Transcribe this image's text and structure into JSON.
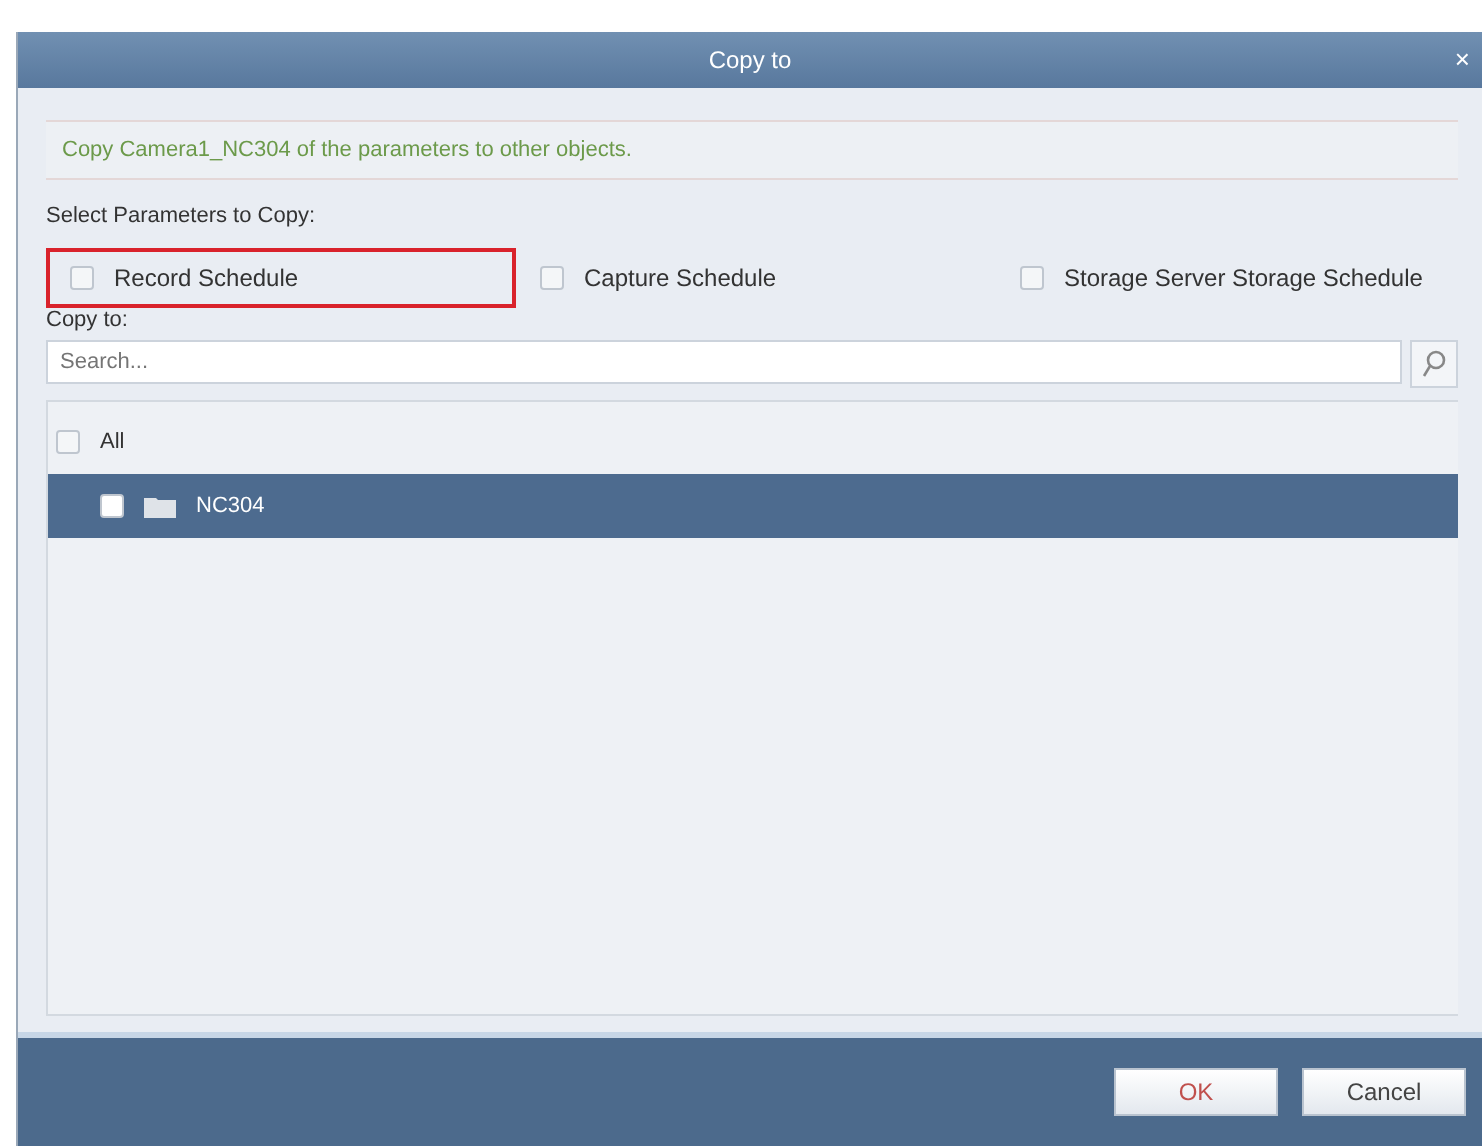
{
  "dialog": {
    "title": "Copy to",
    "close": "×"
  },
  "info": "Copy Camera1_NC304 of the parameters to other objects.",
  "parameters_label": "Select Parameters to Copy:",
  "parameters": [
    {
      "label": "Record Schedule",
      "checked": false,
      "highlighted": true
    },
    {
      "label": "Capture Schedule",
      "checked": false,
      "highlighted": false
    },
    {
      "label": "Storage Server Storage Schedule",
      "checked": false,
      "highlighted": false
    }
  ],
  "copy_to_label": "Copy to:",
  "search": {
    "placeholder": "Search..."
  },
  "tree": [
    {
      "label": "All",
      "checked": false,
      "selected": false,
      "children": [
        {
          "label": "NC304",
          "checked": false,
          "selected": true
        }
      ]
    }
  ],
  "buttons": [
    {
      "label": "OK",
      "kind": "primary"
    },
    {
      "label": "Cancel",
      "kind": "secondary"
    }
  ]
}
